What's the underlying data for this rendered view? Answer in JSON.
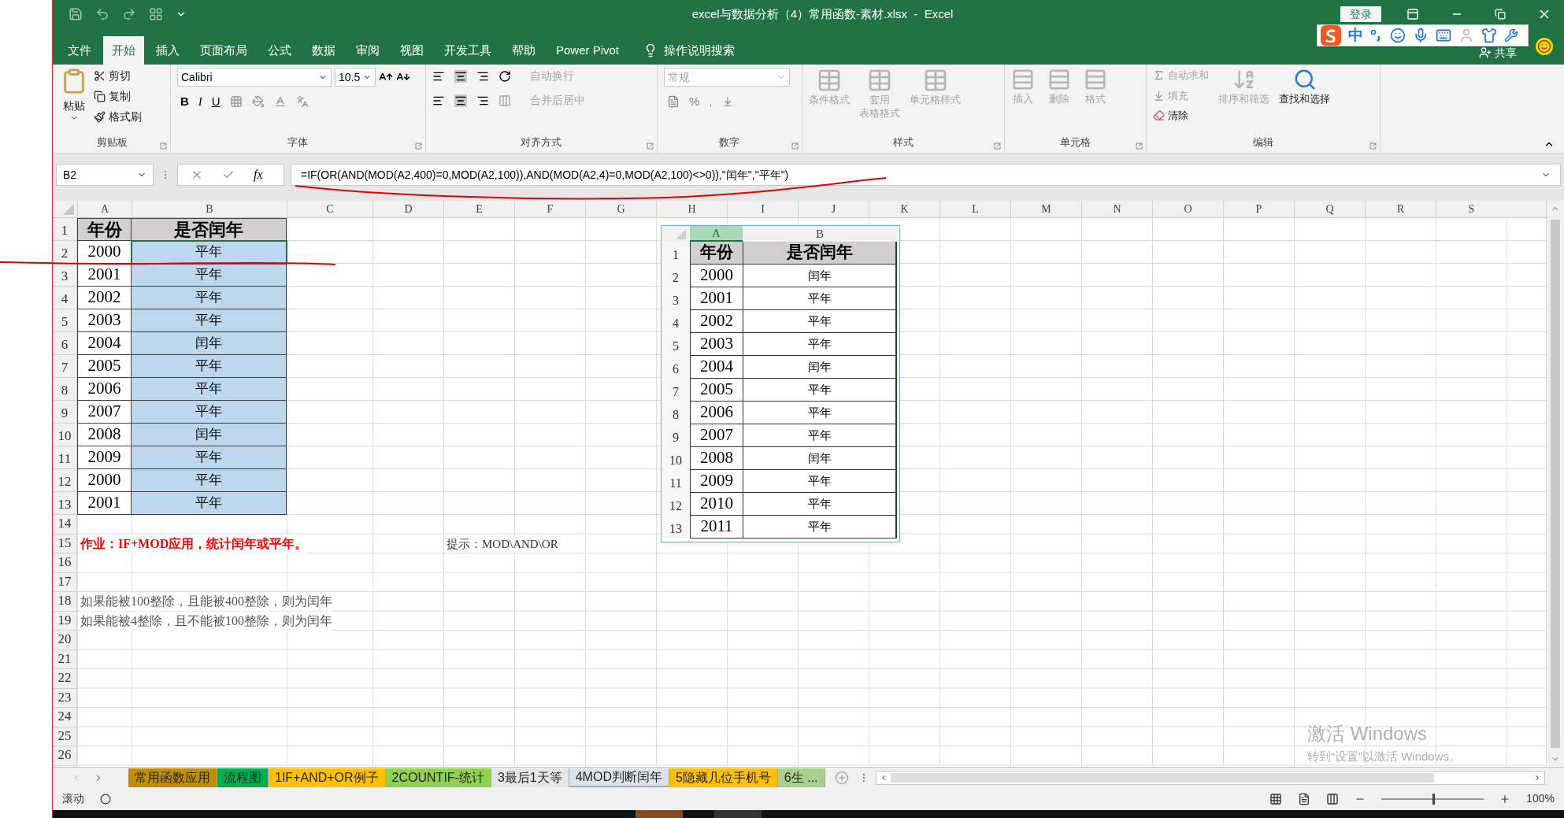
{
  "title_bar": {
    "title": "excel与数据分析（4）常用函数-素材.xlsx  -  Excel",
    "sign_in": "登录"
  },
  "ime_toolbar": {
    "mode": "中"
  },
  "menu": {
    "tabs": [
      {
        "label": "文件",
        "selected": false
      },
      {
        "label": "开始",
        "selected": true
      },
      {
        "label": "插入",
        "selected": false
      },
      {
        "label": "页面布局",
        "selected": false
      },
      {
        "label": "公式",
        "selected": false
      },
      {
        "label": "数据",
        "selected": false
      },
      {
        "label": "审阅",
        "selected": false
      },
      {
        "label": "视图",
        "selected": false
      },
      {
        "label": "开发工具",
        "selected": false
      },
      {
        "label": "帮助",
        "selected": false
      },
      {
        "label": "Power Pivot",
        "selected": false
      }
    ],
    "tell_me": "操作说明搜索",
    "share": "共享"
  },
  "ribbon": {
    "clipboard": {
      "label": "剪贴板",
      "paste": "粘贴",
      "items": [
        "剪切",
        "复制",
        "格式刷"
      ]
    },
    "font": {
      "label": "字体",
      "name": "Calibri",
      "size": "10.5",
      "styles": [
        "B",
        "I",
        "U"
      ]
    },
    "alignment": {
      "label": "对齐方式",
      "wrap": {
        "label": "自动换行",
        "disabled": true
      },
      "merge": {
        "label": "合并后居中",
        "disabled": true
      }
    },
    "number": {
      "label": "数字",
      "format": "常规",
      "disabled": true,
      "symbols": [
        "%",
        ","
      ]
    },
    "styles": {
      "label": "样式",
      "items": [
        {
          "lines": [
            "条件格式"
          ],
          "disabled": true
        },
        {
          "lines": [
            "套用",
            "表格格式"
          ],
          "disabled": true
        },
        {
          "lines": [
            "单元格样式"
          ],
          "disabled": true
        }
      ]
    },
    "cells": {
      "label": "单元格",
      "items": [
        {
          "label": "插入",
          "disabled": true
        },
        {
          "label": "删除",
          "disabled": true
        },
        {
          "label": "格式",
          "disabled": true
        }
      ]
    },
    "editing": {
      "label": "编辑",
      "items": [
        {
          "kind": "autosum",
          "label": "自动求和",
          "disabled": true
        },
        {
          "kind": "fill",
          "label": "填充",
          "disabled": true
        },
        {
          "kind": "clear",
          "label": "清除",
          "disabled": false
        }
      ],
      "sort": {
        "label": "排序和筛选",
        "disabled": true
      },
      "find": {
        "label": "查找和选择",
        "disabled": false
      }
    }
  },
  "formula_bar": {
    "name_box": "B2",
    "fx": "fx",
    "formula": "=IF(OR(AND(MOD(A2,400)=0,MOD(A2,100)),AND(MOD(A2,4)=0,MOD(A2,100)<>0)),\"闰年\",\"平年\")"
  },
  "sheet": {
    "columns": [
      "A",
      "B",
      "C",
      "D",
      "E",
      "F",
      "G",
      "H",
      "I",
      "J",
      "K",
      "L",
      "M",
      "N",
      "O",
      "P",
      "Q",
      "R",
      "S"
    ],
    "rows": [
      {
        "label": "1",
        "kind": "header",
        "a": "年份",
        "b": "是否闰年",
        "selected": false
      },
      {
        "label": "2",
        "kind": "data",
        "a": "2000",
        "b": "平年",
        "selected": true
      },
      {
        "label": "3",
        "kind": "data",
        "a": "2001",
        "b": "平年",
        "selected": false
      },
      {
        "label": "4",
        "kind": "data",
        "a": "2002",
        "b": "平年",
        "selected": false
      },
      {
        "label": "5",
        "kind": "data",
        "a": "2003",
        "b": "平年",
        "selected": false
      },
      {
        "label": "6",
        "kind": "data",
        "a": "2004",
        "b": "闰年",
        "selected": false
      },
      {
        "label": "7",
        "kind": "data",
        "a": "2005",
        "b": "平年",
        "selected": false
      },
      {
        "label": "8",
        "kind": "data",
        "a": "2006",
        "b": "平年",
        "selected": false
      },
      {
        "label": "9",
        "kind": "data",
        "a": "2007",
        "b": "平年",
        "selected": false
      },
      {
        "label": "10",
        "kind": "data",
        "a": "2008",
        "b": "闰年",
        "selected": false
      },
      {
        "label": "11",
        "kind": "data",
        "a": "2009",
        "b": "平年",
        "selected": false
      },
      {
        "label": "12",
        "kind": "data",
        "a": "2000",
        "b": "平年",
        "selected": false
      },
      {
        "label": "13",
        "kind": "data",
        "a": "2001",
        "b": "平年",
        "selected": false
      },
      {
        "label": "14",
        "kind": "blank",
        "selected": false
      },
      {
        "label": "15",
        "kind": "note",
        "a": "作业：IF+MOD应用，统计闰年或平年。",
        "e": "提示：MOD\\AND\\OR",
        "selected": false
      },
      {
        "label": "16",
        "kind": "blank",
        "selected": false
      },
      {
        "label": "17",
        "kind": "blank",
        "selected": false
      },
      {
        "label": "18",
        "kind": "text",
        "a": "如果能被100整除，且能被400整除，则为闰年",
        "selected": false
      },
      {
        "label": "19",
        "kind": "text",
        "a": "如果能被4整除，且不能被100整除，则为闰年",
        "selected": false
      },
      {
        "label": "20",
        "kind": "blank",
        "selected": false
      },
      {
        "label": "21",
        "kind": "blank",
        "selected": false
      },
      {
        "label": "22",
        "kind": "blank",
        "selected": false
      },
      {
        "label": "23",
        "kind": "blank",
        "selected": false
      },
      {
        "label": "24",
        "kind": "blank",
        "selected": false
      },
      {
        "label": "25",
        "kind": "blank",
        "selected": false
      },
      {
        "label": "26",
        "kind": "blank",
        "selected": false
      }
    ]
  },
  "embedded_table": {
    "columns": [
      {
        "label": "A",
        "selected": true
      },
      {
        "label": "B",
        "selected": false
      }
    ],
    "rows": [
      {
        "label": "1",
        "kind": "header",
        "a": "年份",
        "b": "是否闰年"
      },
      {
        "label": "2",
        "kind": "data",
        "a": "2000",
        "b": "闰年"
      },
      {
        "label": "3",
        "kind": "data",
        "a": "2001",
        "b": "平年"
      },
      {
        "label": "4",
        "kind": "data",
        "a": "2002",
        "b": "平年"
      },
      {
        "label": "5",
        "kind": "data",
        "a": "2003",
        "b": "平年"
      },
      {
        "label": "6",
        "kind": "data",
        "a": "2004",
        "b": "闰年"
      },
      {
        "label": "7",
        "kind": "data",
        "a": "2005",
        "b": "平年"
      },
      {
        "label": "8",
        "kind": "data",
        "a": "2006",
        "b": "平年"
      },
      {
        "label": "9",
        "kind": "data",
        "a": "2007",
        "b": "平年"
      },
      {
        "label": "10",
        "kind": "data",
        "a": "2008",
        "b": "闰年"
      },
      {
        "label": "11",
        "kind": "data",
        "a": "2009",
        "b": "平年"
      },
      {
        "label": "12",
        "kind": "data",
        "a": "2010",
        "b": "平年"
      },
      {
        "label": "13",
        "kind": "data",
        "a": "2011",
        "b": "平年"
      }
    ]
  },
  "activation_notice": {
    "title": "激活 Windows",
    "text": "转到“设置”以激活 Windows。"
  },
  "sheet_tabs": [
    {
      "label": "常用函数应用",
      "color": "#bf8f00",
      "selected": false
    },
    {
      "label": "流程图",
      "color": "#00b050",
      "selected": false
    },
    {
      "label": "1IF+AND+OR例子",
      "color": "#ffc000",
      "selected": false
    },
    {
      "label": "2COUNTIF-统计",
      "color": "#92d050",
      "selected": false
    },
    {
      "label": "3最后1天等",
      "color": "#e7e6e6",
      "selected": false
    },
    {
      "label": "4MOD判断闰年",
      "color": "#dde3ea",
      "selected": true
    },
    {
      "label": "5隐藏几位手机号",
      "color": "#ffc000",
      "selected": false
    },
    {
      "label": "6生 ...",
      "color": "#a9d08e",
      "selected": false
    }
  ],
  "status_bar": {
    "mode": "滚动",
    "zoom": "100%",
    "zoom_level": {
      "level": 0.5
    }
  }
}
